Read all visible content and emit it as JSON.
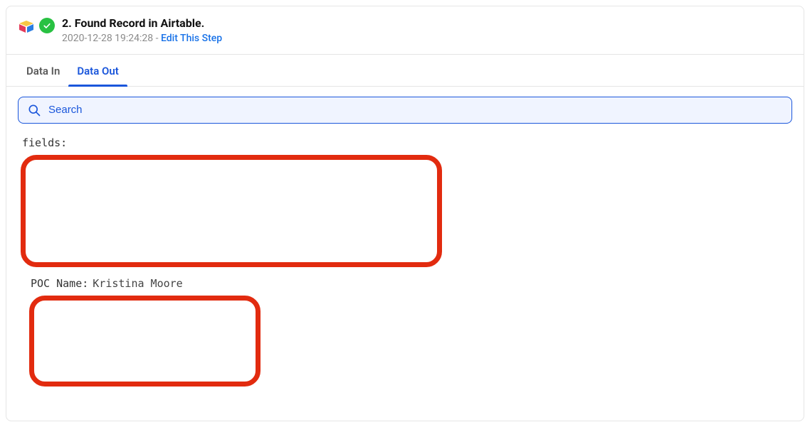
{
  "header": {
    "title": "2. Found Record in Airtable.",
    "timestamp": "2020-12-28 19:24:28",
    "separator": " - ",
    "edit_link": "Edit This Step"
  },
  "tabs": {
    "data_in": "Data In",
    "data_out": "Data Out",
    "active": "data_out"
  },
  "search": {
    "placeholder": "Search",
    "value": ""
  },
  "data_out": {
    "fields_label": "fields:",
    "poc_name_key": "POC Name:",
    "poc_name_value": "Kristina Moore"
  },
  "icons": {
    "check": "✓",
    "search": "search"
  },
  "colors": {
    "accent": "#1a56db",
    "success": "#28c142",
    "redaction": "#e22b0f"
  }
}
